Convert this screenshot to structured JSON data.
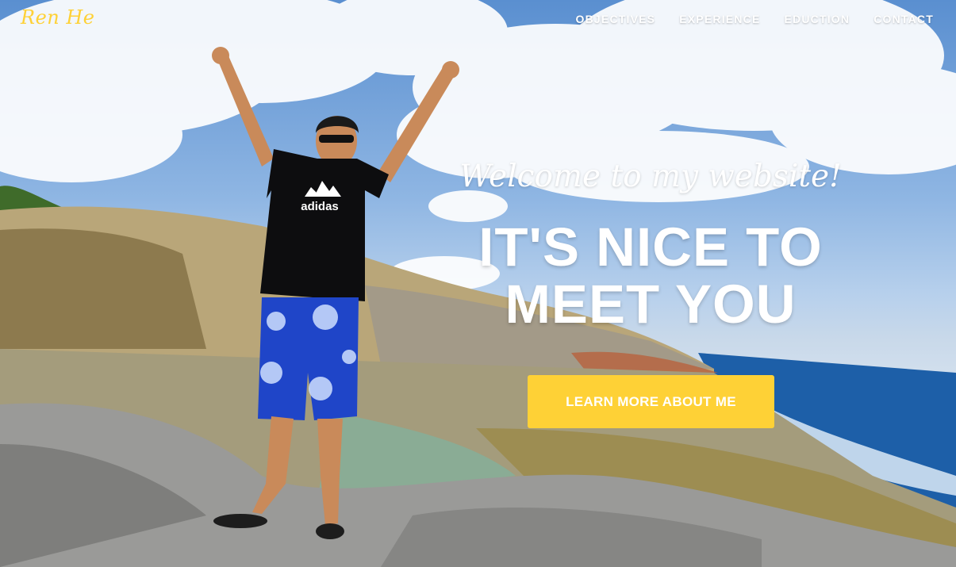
{
  "navbar": {
    "brand": "Ren He",
    "links": [
      {
        "label": "OBJECTIVES"
      },
      {
        "label": "EXPERIENCE"
      },
      {
        "label": "EDUCTION"
      },
      {
        "label": "CONTACT"
      }
    ]
  },
  "intro": {
    "lead": "Welcome to my website!",
    "heading_line1": "IT'S NICE TO",
    "heading_line2": "MEET YOU",
    "button_label": "LEARN MORE ABOUT ME"
  },
  "colors": {
    "accent": "#fed136",
    "text": "#ffffff"
  },
  "background": {
    "icon": "hero-photo-person-on-coastal-rocks",
    "shirt_logo_text": "adidas"
  }
}
